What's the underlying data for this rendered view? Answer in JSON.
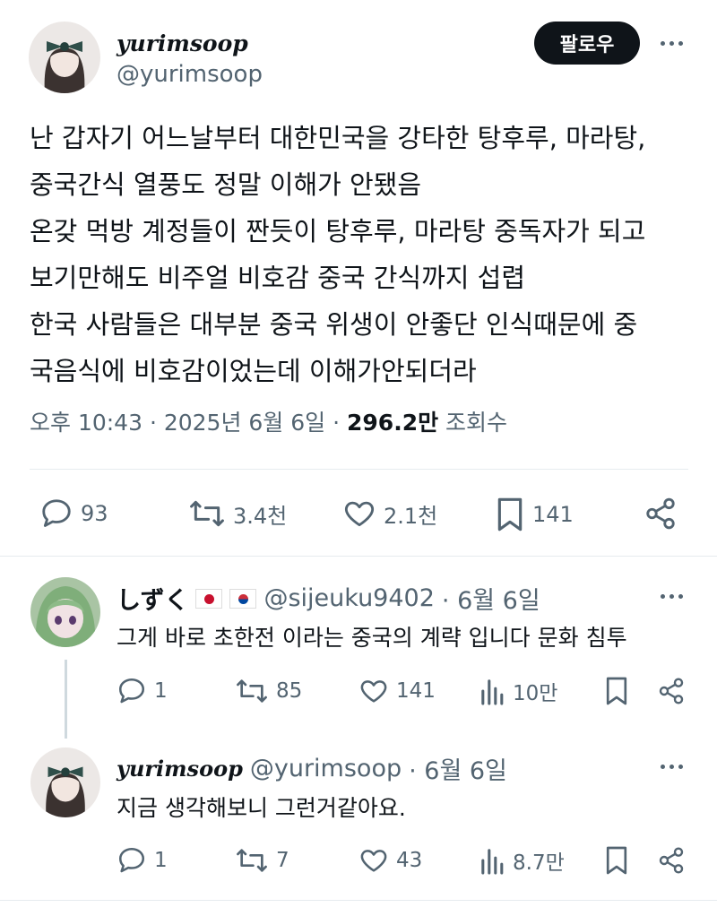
{
  "tweet": {
    "display_name": "yurimsoop",
    "handle": "@yurimsoop",
    "follow_label": "팔로우",
    "lines": [
      "난 갑자기 어느날부터 대한민국을 강타한 탕후루, 마라탕,",
      "중국간식 열풍도 정말 이해가 안됐음",
      "온갖 먹방 계정들이 짠듯이 탕후루, 마라탕 중독자가 되고",
      "보기만해도 비주얼 비호감 중국 간식까지 섭렵",
      "한국 사람들은 대부분 중국 위생이 안좋단 인식때문에 중",
      "국음식에 비호감이었는데 이해가안되더라"
    ],
    "time": "오후 10:43 · 2025년 6월 6일 ·",
    "views_count": "296.2만",
    "views_label": "조회수",
    "stats": {
      "replies": "93",
      "retweets": "3.4천",
      "likes": "2.1천",
      "bookmarks": "141"
    }
  },
  "replies": [
    {
      "name": "しずく",
      "handle": "@sijeuku9402",
      "date": "· 6월 6일",
      "text": "그게 바로 초한전 이라는 중국의 계략 입니다 문화 침투",
      "stats": {
        "replies": "1",
        "retweets": "85",
        "likes": "141",
        "views": "10만"
      }
    },
    {
      "name": "yurimsoop",
      "handle": "@yurimsoop",
      "date": "· 6월 6일",
      "text": "지금 생각해보니 그런거같아요.",
      "stats": {
        "replies": "1",
        "retweets": "7",
        "likes": "43",
        "views": "8.7만"
      }
    }
  ],
  "colors": {
    "text": "#0f1419",
    "muted": "#536471",
    "divider": "#e6ebef",
    "button": "#0f1419"
  }
}
